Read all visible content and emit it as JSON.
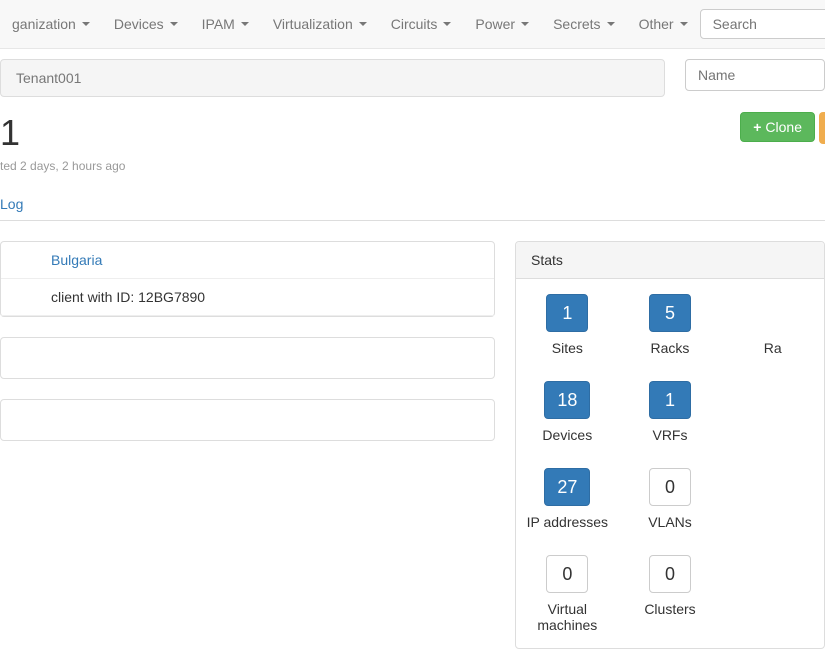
{
  "navbar": {
    "items": [
      {
        "label": "ganization"
      },
      {
        "label": "Devices"
      },
      {
        "label": "IPAM"
      },
      {
        "label": "Virtualization"
      },
      {
        "label": "Circuits"
      },
      {
        "label": "Power"
      },
      {
        "label": "Secrets"
      },
      {
        "label": "Other"
      }
    ],
    "search_placeholder": "Search"
  },
  "breadcrumb": {
    "text": "Tenant001",
    "name_placeholder": "Name"
  },
  "header": {
    "title": "1",
    "clone_label": "Clone",
    "timestamp": "ted 2 days, 2 hours ago"
  },
  "tabs": {
    "log_label": "Log"
  },
  "details": {
    "country": "Bulgaria",
    "client_id": "client with ID: 12BG7890"
  },
  "stats": {
    "heading": "Stats",
    "items": [
      {
        "value": "1",
        "label": "Sites",
        "filled": true
      },
      {
        "value": "5",
        "label": "Racks",
        "filled": true
      },
      {
        "value": "",
        "label": "Ra",
        "partial": true
      },
      {
        "value": "18",
        "label": "Devices",
        "filled": true
      },
      {
        "value": "1",
        "label": "VRFs",
        "filled": true
      },
      {
        "value": "",
        "label": "",
        "partial": true
      },
      {
        "value": "27",
        "label": "IP addresses",
        "filled": true
      },
      {
        "value": "0",
        "label": "VLANs",
        "filled": false
      },
      {
        "value": "",
        "label": "",
        "partial": true
      },
      {
        "value": "0",
        "label": "Virtual machines",
        "filled": false
      },
      {
        "value": "0",
        "label": "Clusters",
        "filled": false
      },
      {
        "value": "",
        "label": "",
        "partial": true
      }
    ]
  }
}
